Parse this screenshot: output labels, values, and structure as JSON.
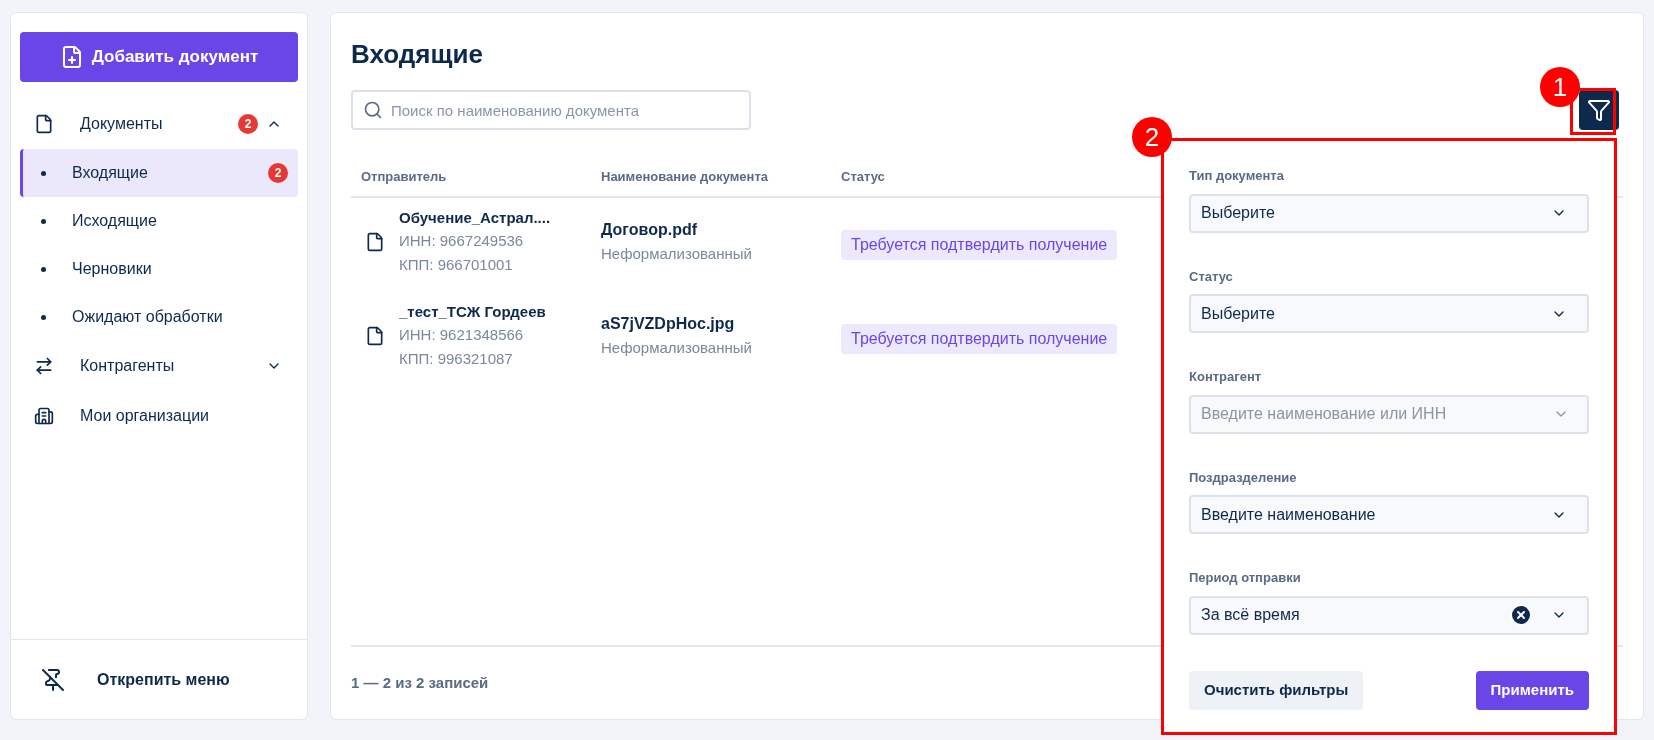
{
  "sidebar": {
    "add_button": "Добавить документ",
    "nav": [
      {
        "label": "Документы",
        "kind": "group",
        "badge": "2",
        "expanded": true,
        "children": [
          {
            "label": "Входящие",
            "selected": true,
            "badge": "2"
          },
          {
            "label": "Исходящие",
            "selected": false
          },
          {
            "label": "Черновики",
            "selected": false
          },
          {
            "label": "Ожидают обработки",
            "selected": false
          }
        ]
      },
      {
        "label": "Контрагенты",
        "kind": "group",
        "expanded": false
      },
      {
        "label": "Мои организации",
        "kind": "link"
      }
    ],
    "unpin": "Открепить меню"
  },
  "main": {
    "title": "Входящие",
    "search": {
      "placeholder": "Поиск по наименованию документа"
    },
    "table": {
      "columns": [
        "Отправитель",
        "Наименование документа",
        "Статус"
      ],
      "rows": [
        {
          "sender": "Обучение_Астрал....",
          "inn": "ИНН: 9667249536",
          "kpp": "КПП: 966701001",
          "document": "Договор.pdf",
          "doc_type": "Неформализованный",
          "status": "Требуется подтвердить получение"
        },
        {
          "sender": "_тест_ТСЖ Гордеев",
          "inn": "ИНН: 9621348566",
          "kpp": "КПП: 996321087",
          "document": "aS7jVZDpHoc.jpg",
          "doc_type": "Неформализованный",
          "status": "Требуется подтвердить получение"
        }
      ]
    },
    "pagination": "1 — 2 из 2 записей"
  },
  "filter_panel": {
    "fields": [
      {
        "label": "Тип документа",
        "value": "Выберите"
      },
      {
        "label": "Статус",
        "value": "Выберите"
      },
      {
        "label": "Контрагент",
        "placeholder": "Введите наименование или ИНН"
      },
      {
        "label": "Поздразделение",
        "value": "Введите наименование"
      },
      {
        "label": "Период отправки",
        "value": "За всё время",
        "clearable": true
      }
    ],
    "clear_button": "Очистить фильтры",
    "apply_button": "Применить"
  },
  "annotations": [
    "1",
    "2"
  ]
}
